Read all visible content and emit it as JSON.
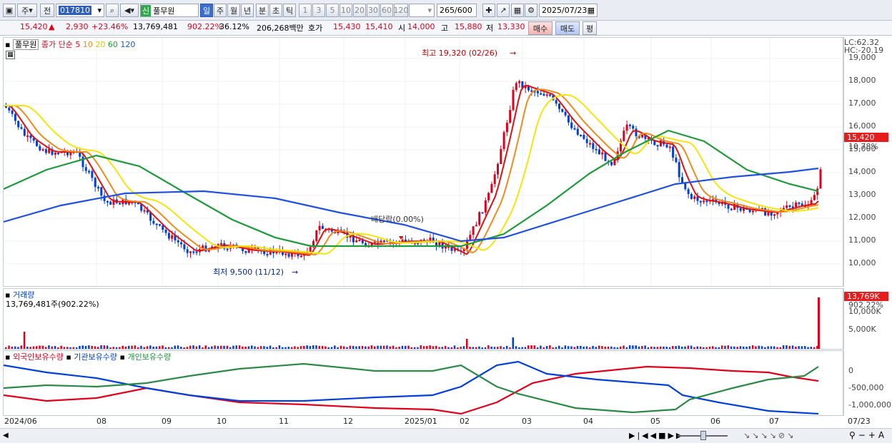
{
  "toolbar": {
    "period_btn": "주",
    "prev_btn": "전",
    "stock_code": "017810",
    "new_badge": "신",
    "stock_name": "풀무원",
    "periods": [
      "일",
      "주",
      "월",
      "년",
      "분",
      "초",
      "틱"
    ],
    "active_period": "일",
    "intervals": [
      "1",
      "3",
      "5",
      "10",
      "20",
      "30",
      "60",
      "120"
    ],
    "count_value": "265",
    "count_total": "/600",
    "date_value": "2025/07/23"
  },
  "quote": {
    "price": "15,420",
    "change": "2,930",
    "change_pct": "+23.46%",
    "volume": "13,769,481",
    "volume_ratio": "902.22%",
    "turnover": "36.12%",
    "amount": "206,268백만",
    "bid_label": "호가",
    "ask": "15,430",
    "bid": "15,410",
    "open_label": "시",
    "open": "14,000",
    "high_label": "고",
    "high": "15,880",
    "low_label": "저",
    "low": "13,330",
    "buy_btn": "매수",
    "sell_btn": "매도",
    "eval_btn": "평"
  },
  "price_panel": {
    "name_tag": "풀무원",
    "legend_label": "종가 단순",
    "ma_periods": [
      "5",
      "10",
      "20",
      "60",
      "120"
    ],
    "lc_label": "LC:62.32",
    "hc_label": "HC:-20.19",
    "y_ticks": [
      "19,000",
      "18,000",
      "17,000",
      "16,000",
      "15,000",
      "14,000",
      "13,000",
      "12,000",
      "11,000",
      "10,000"
    ],
    "current_price_tag": "15,420",
    "current_pct_tag": "10.78%",
    "high_annotation": "최고 19,320 (02/26)",
    "low_annotation": "최저 9,500 (11/12)",
    "dividend_annotation": "배당락(0.00%)"
  },
  "volume_panel": {
    "title": "거래량",
    "value_text": "13,769,481주(902.22%)",
    "y_ticks": [
      "10,000K",
      "5,000K"
    ],
    "current_tag": "13,769K",
    "current_pct": "902.22%"
  },
  "holdings_panel": {
    "legend": [
      "외국인보유수량",
      "기관보유수량",
      "개인보유수량"
    ],
    "y_ticks": [
      "0",
      "-500,000",
      "-1,000,000"
    ]
  },
  "x_labels": [
    "2024/06",
    "08",
    "09",
    "10",
    "11",
    "12",
    "2025/01",
    "02",
    "03",
    "04",
    "05",
    "06",
    "07",
    "07/23"
  ],
  "colors": {
    "up": "#e0001c",
    "down": "#0040d8",
    "ma5": "#e01010",
    "ma10": "#f08a1c",
    "ma20": "#f5e50a",
    "ma60": "#1e9a3a",
    "ma120": "#2050e0"
  }
}
